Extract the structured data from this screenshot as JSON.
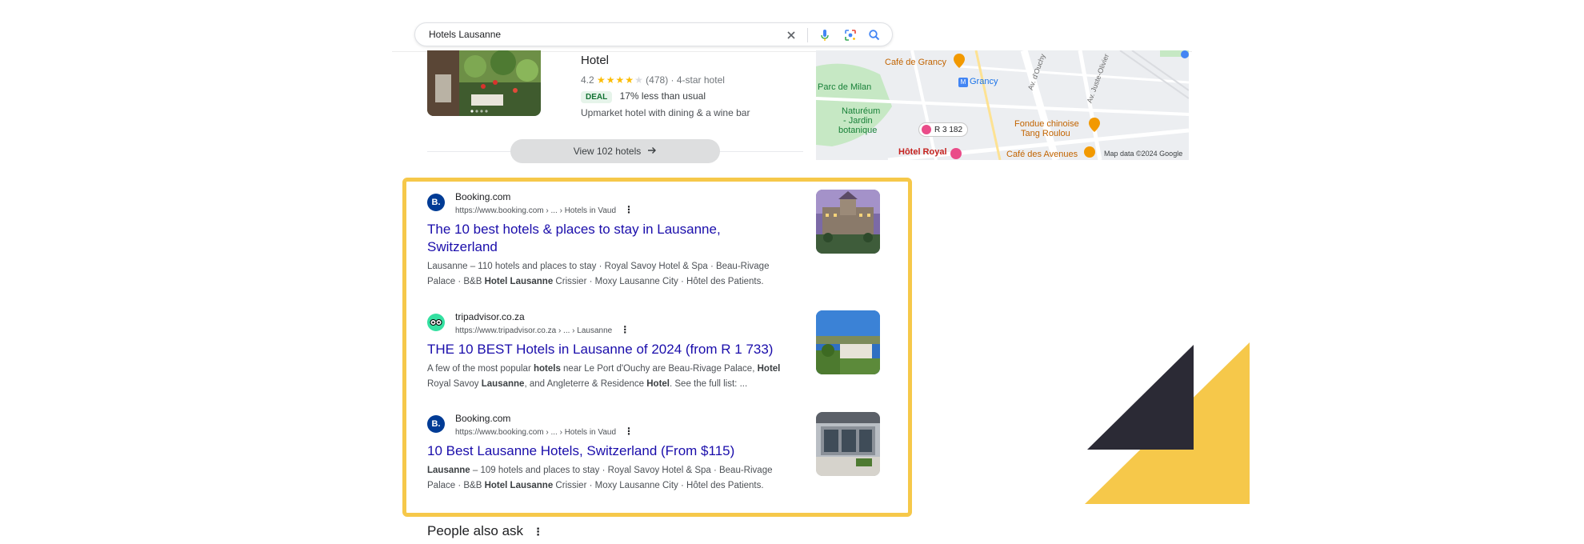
{
  "search": {
    "query": "Hotels Lausanne",
    "icons": [
      "close-icon",
      "microphone-icon",
      "lens-icon",
      "search-icon"
    ]
  },
  "hotel_card": {
    "name": "Hotel",
    "rating": "4.2",
    "stars_filled": 4,
    "stars_total": 5,
    "reviews": "(478)",
    "hotel_class": "4-star hotel",
    "deal_badge": "DEAL",
    "deal_text": "17% less than usual",
    "description": "Upmarket hotel with dining & a wine bar",
    "view_button": "View 102 hotels"
  },
  "map": {
    "labels": {
      "cafe_grancy": "Café de Grancy",
      "grancy": "Grancy",
      "parc_milan": "Parc de Milan",
      "natureum_1": "Naturéum",
      "natureum_2": "- Jardin",
      "natureum_3": "botanique",
      "fondue_1": "Fondue chinoise",
      "fondue_2": "Tang Roulou",
      "hotel_royal": "Hôtel Royal",
      "cafe_avenues": "Café des Avenues",
      "road_dapples": "Av. d'Ouchy",
      "road_juste": "Av. Juste-Olivier"
    },
    "price_pin": "R 3 182",
    "attribution": "Map data ©2024 Google",
    "colors": {
      "park": "#c8e6c9",
      "road": "#ffffff",
      "pin_red": "#ea4c89",
      "pin_orange": "#f29900",
      "blue": "#4285f4"
    }
  },
  "results": [
    {
      "site_name": "Booking.com",
      "url": "https://www.booking.com › ... › Hotels in Vaud",
      "favicon": "B.",
      "title_line1": "The 10 best hotels & places to stay in Lausanne,",
      "title_line2": "Switzerland",
      "snippet_line1": "Lausanne – 110 hotels and places to stay · Royal Savoy Hotel & Spa · Beau-Rivage",
      "snippet_line2a": "Palace · B&B ",
      "snippet_line2b": "Hotel Lausanne",
      "snippet_line2c": " Crissier · Moxy Lausanne City · Hôtel des Patients."
    },
    {
      "site_name": "tripadvisor.co.za",
      "url": "https://www.tripadvisor.co.za › ... › Lausanne",
      "favicon": "owl",
      "title_line1": "THE 10 BEST Hotels in Lausanne of 2024 (from R 1 733)",
      "snippet_line1a": "A few of the most popular ",
      "snippet_line1b": "hotels",
      "snippet_line1c": " near Le Port d'Ouchy are Beau-Rivage Palace, ",
      "snippet_line1d": "Hotel",
      "snippet_line2a": "Royal Savoy ",
      "snippet_line2b": "Lausanne",
      "snippet_line2c": ", and Angleterre & Residence ",
      "snippet_line2d": "Hotel",
      "snippet_line2e": ". See the full list: ..."
    },
    {
      "site_name": "Booking.com",
      "url": "https://www.booking.com › ... › Hotels in Vaud",
      "favicon": "B.",
      "title_line1": "10 Best Lausanne Hotels, Switzerland (From $115)",
      "snippet_line1a": "Lausanne",
      "snippet_line1b": " – 109 hotels and places to stay · Royal Savoy Hotel & Spa · Beau-Rivage",
      "snippet_line2a": "Palace · B&B ",
      "snippet_line2b": "Hotel Lausanne",
      "snippet_line2c": " Crissier · Moxy Lausanne City · Hôtel des Patients."
    }
  ],
  "people_also_ask": "People also ask",
  "colors": {
    "highlight": "#f6c84a",
    "link": "#1a0dab",
    "booking_blue": "#003b95",
    "tripadvisor_green": "#34e0a1",
    "deco_dark": "#2b2a35",
    "deco_yellow": "#f6c84a"
  }
}
